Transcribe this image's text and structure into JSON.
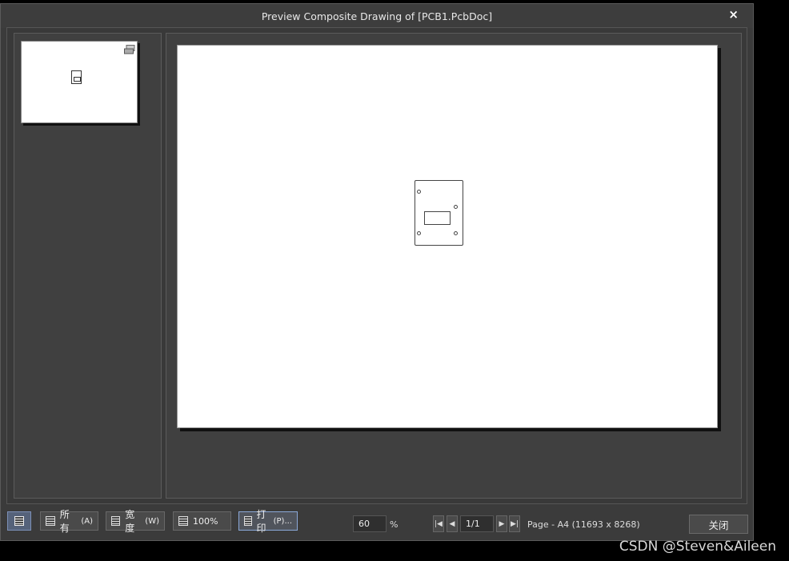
{
  "window": {
    "title": "Preview Composite Drawing of [PCB1.PcbDoc]",
    "close_glyph": "×"
  },
  "toolbar": {
    "view_toggle_icon": "panel-icon",
    "all_label": "所有",
    "all_shortcut": "(A)",
    "width_label": "宽度",
    "width_shortcut": "(W)",
    "zoom100_label": "100%",
    "print_label": "打印",
    "print_shortcut": "(P)..."
  },
  "zoom": {
    "value": "60",
    "unit": "%"
  },
  "navigation": {
    "first": "|◀",
    "prev": "◀",
    "page": "1/1",
    "next": "▶",
    "last": "▶|"
  },
  "page_info": "Page - A4 (11693 x 8268)",
  "close_button": "关闭",
  "watermark": "CSDN @Steven&Aileen"
}
